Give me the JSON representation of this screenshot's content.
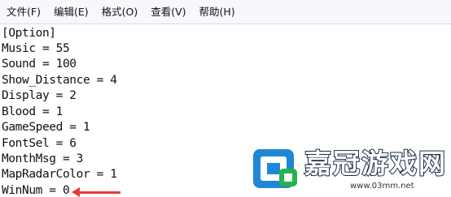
{
  "menu": {
    "file": "文件(F)",
    "edit": "编辑(E)",
    "format": "格式(O)",
    "view": "查看(V)",
    "help": "帮助(H)"
  },
  "lines": [
    "[Option]",
    "Music = 55",
    "Sound = 100",
    "Show_Distance = 4",
    "Display = 2",
    "Blood = 1",
    "GameSpeed = 1",
    "FontSel = 6",
    "MonthMsg = 3",
    "MapRadarColor = 1",
    "WinNum = 0"
  ],
  "watermark": {
    "brand": "嘉冠游戏网",
    "url": "www.03mm.net",
    "colors": {
      "blue": "#1e88d6",
      "green": "#27b24a",
      "dark": "#1d2a44"
    }
  },
  "arrow_color": "#e53a3a"
}
